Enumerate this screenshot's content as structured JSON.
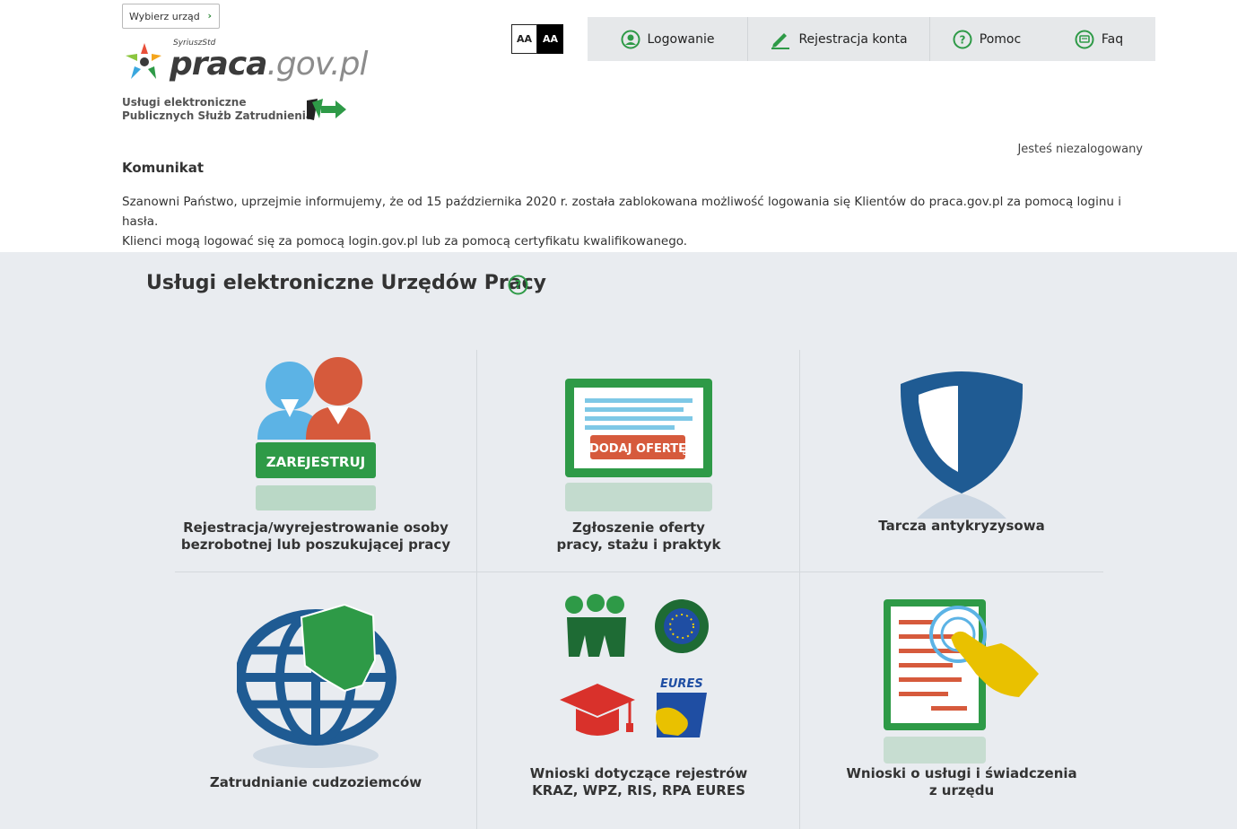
{
  "header": {
    "office_button": "Wybierz urząd",
    "logo_superscript": "SyriuszStd",
    "logo_part1": "praca",
    "logo_part2": ".gov.pl",
    "psz_line1": "Usługi elektroniczne",
    "psz_line2": "Publicznych Służb Zatrudnienia",
    "contrast_normal": "AA",
    "contrast_high": "AA",
    "nav": [
      {
        "label": "Logowanie",
        "icon": "user-circle-icon"
      },
      {
        "label": "Rejestracja konta",
        "icon": "pencil-icon"
      },
      {
        "label": "Pomoc",
        "icon": "question-circle-icon"
      },
      {
        "label": "Faq",
        "icon": "chat-bubble-icon"
      }
    ],
    "login_status": "Jesteś niezalogowany"
  },
  "message": {
    "title": "Komunikat",
    "line1": "Szanowni Państwo, uprzejmie informujemy, że od 15 października 2020 r. została zablokowana możliwość logowania się Klientów do praca.gov.pl za pomocą loginu i hasła.",
    "line2": "Klienci mogą logować się za pomocą login.gov.pl lub za pomocą certyfikatu kwalifikowanego."
  },
  "services": {
    "title": "Usługi elektroniczne Urzędów Pracy",
    "tiles": [
      {
        "line1": "Rejestracja/wyrejestrowanie osoby",
        "line2": "bezrobotnej lub poszukującej pracy",
        "badge": "ZAREJESTRUJ"
      },
      {
        "line1": "Zgłoszenie oferty",
        "line2": "pracy, stażu i praktyk",
        "badge": "DODAJ OFERTĘ"
      },
      {
        "line1": "Tarcza antykryzysowa",
        "line2": ""
      },
      {
        "line1": "Zatrudnianie cudzoziemców",
        "line2": ""
      },
      {
        "line1": "Wnioski dotyczące rejestrów",
        "line2": "KRAZ, WPZ, RIS, RPA EURES",
        "badge": "EURES"
      },
      {
        "line1": "Wnioski o usługi i świadczenia",
        "line2": "z urzędu"
      }
    ]
  },
  "colors": {
    "green": "#2e9a47",
    "orange": "#d65a3c",
    "blue": "#1f5b93",
    "light_blue": "#5cb3e5",
    "red": "#d9312b",
    "yellow": "#e9c100",
    "page_bg": "#e9ecf0"
  }
}
